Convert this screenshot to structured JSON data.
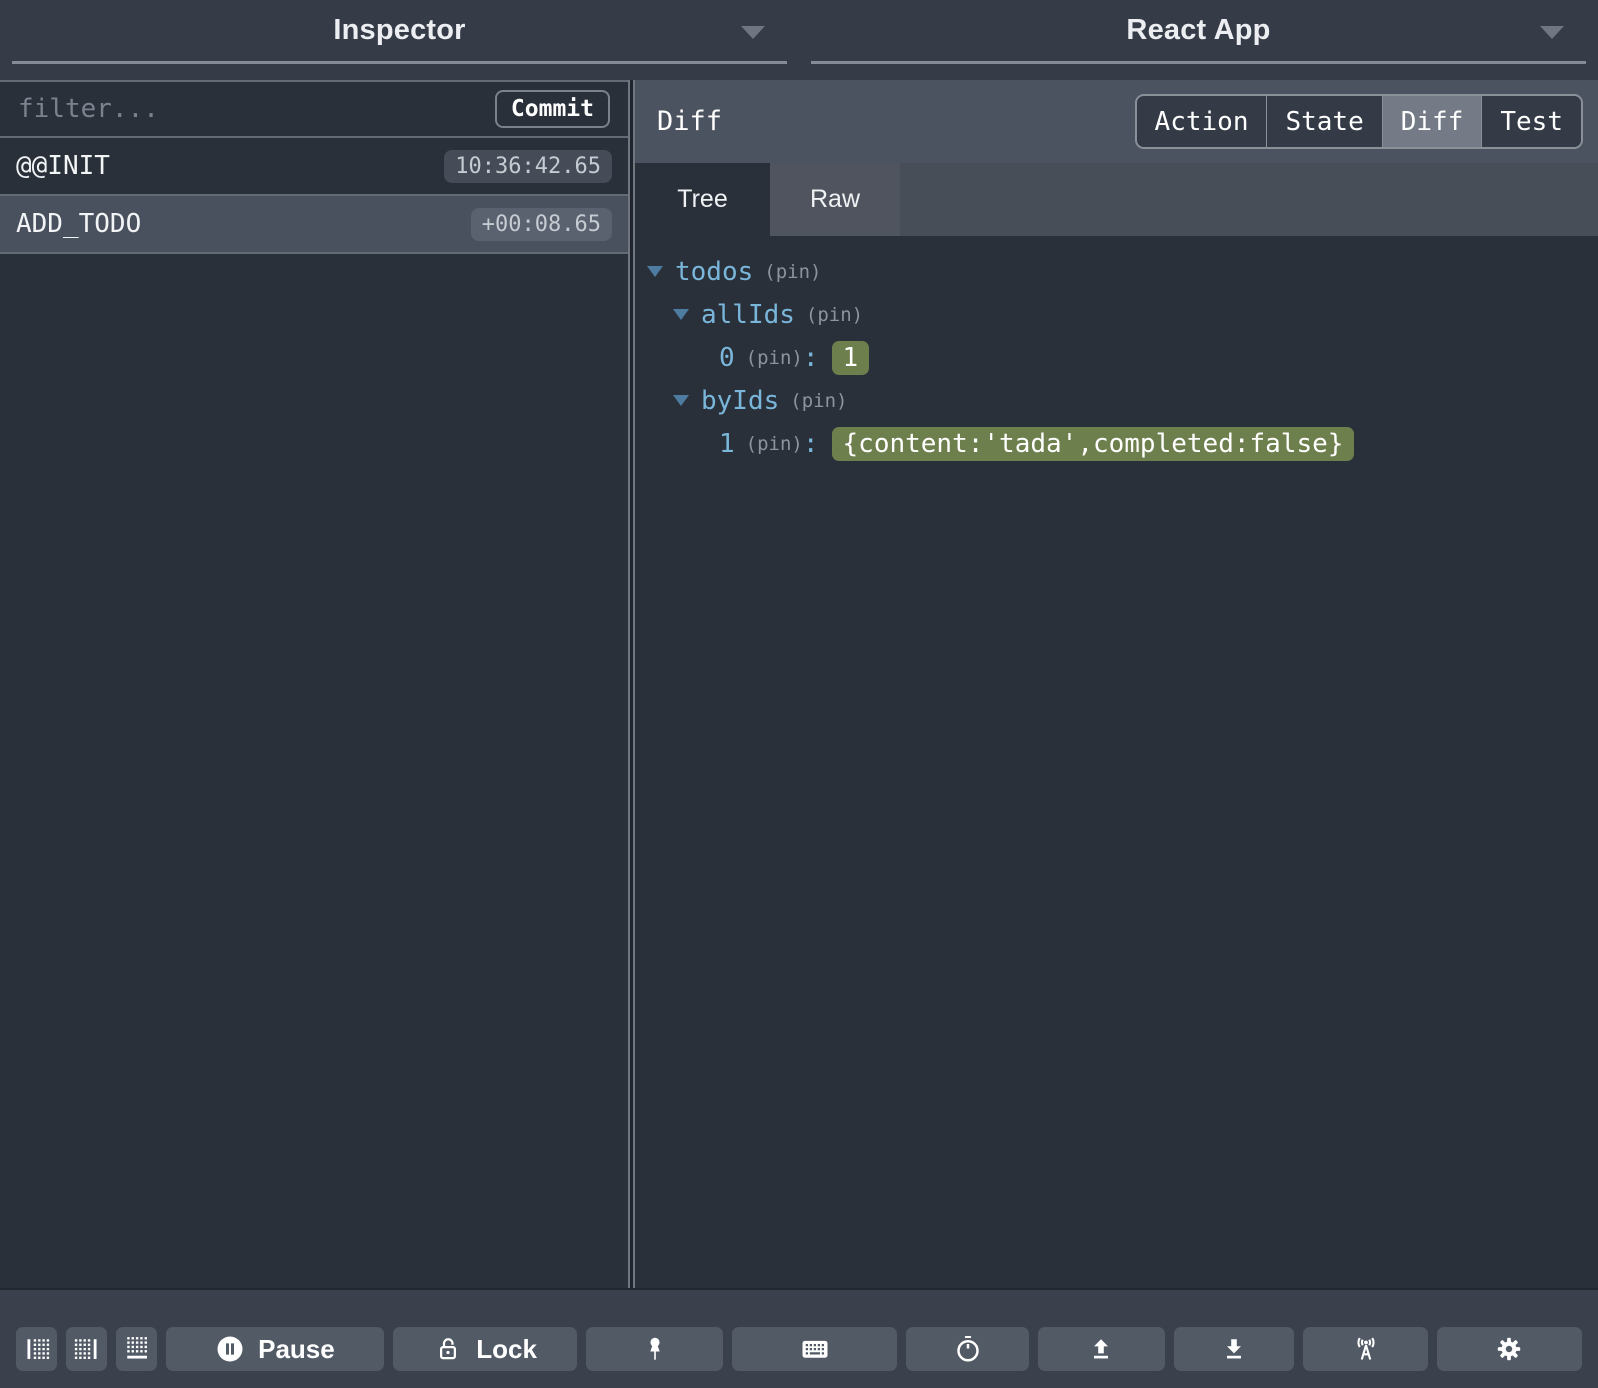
{
  "header": {
    "inspector_title": "Inspector",
    "app_title": "React App"
  },
  "left_panel": {
    "filter_placeholder": "filter...",
    "filter_value": "",
    "commit_label": "Commit",
    "actions": [
      {
        "name": "@@INIT",
        "time": "10:36:42.65",
        "selected": false
      },
      {
        "name": "ADD_TODO",
        "time": "+00:08.65",
        "selected": true
      }
    ]
  },
  "right_panel": {
    "title": "Diff",
    "tabs": [
      {
        "label": "Action",
        "selected": false
      },
      {
        "label": "State",
        "selected": false
      },
      {
        "label": "Diff",
        "selected": true
      },
      {
        "label": "Test",
        "selected": false
      }
    ],
    "subtabs": [
      {
        "label": "Tree",
        "selected": true
      },
      {
        "label": "Raw",
        "selected": false
      }
    ],
    "tree": {
      "pin_label": "(pin)",
      "colon": ":",
      "nodes": [
        {
          "key": "todos",
          "level": 0,
          "type": "branch",
          "expanded": true
        },
        {
          "key": "allIds",
          "level": 1,
          "type": "branch",
          "expanded": true
        },
        {
          "key": "0",
          "level": 2,
          "type": "leaf",
          "value": "1"
        },
        {
          "key": "byIds",
          "level": 1,
          "type": "branch",
          "expanded": true
        },
        {
          "key": "1",
          "level": 2,
          "type": "leaf",
          "value": "{content:'tada',completed:false}"
        }
      ]
    }
  },
  "toolbar": {
    "pause_label": "Pause",
    "lock_label": "Lock",
    "icon_buttons": [
      "dock-left",
      "dock-right",
      "dock-bottom",
      "pause",
      "lock",
      "pin",
      "keyboard",
      "stopwatch",
      "upload",
      "download",
      "broadcast",
      "settings"
    ]
  },
  "colors": {
    "background": "#2a303a",
    "header_bar": "#353b47",
    "panel_header": "#4c5360",
    "selected_row": "#4a515e",
    "key_blue": "#79b6da",
    "diff_added_green": "#6d7f4c",
    "toolbar_bg": "#3a414d",
    "toolbar_button": "#525a66"
  }
}
